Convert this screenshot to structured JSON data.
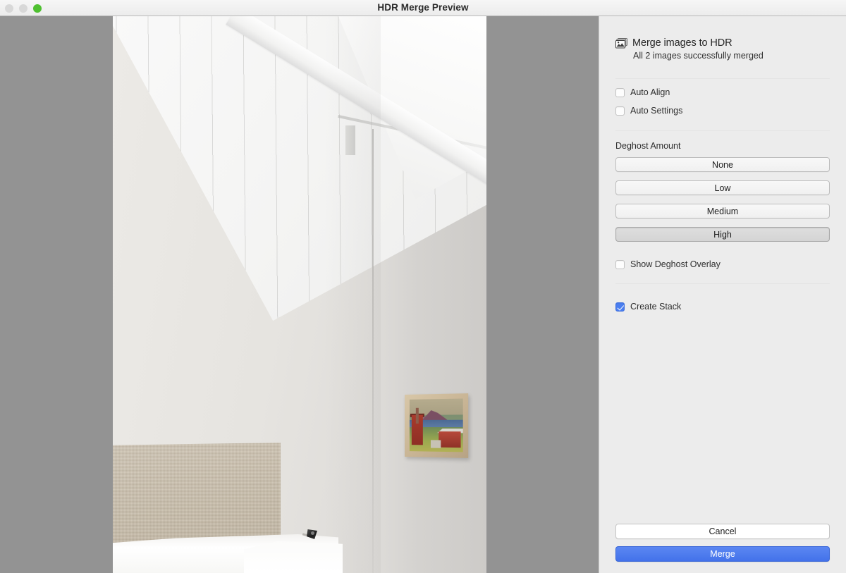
{
  "window": {
    "title": "HDR Merge Preview",
    "traffic_lights": [
      {
        "name": "close",
        "color": "#d8d8d8"
      },
      {
        "name": "minimize",
        "color": "#d8d8d8"
      },
      {
        "name": "zoom",
        "color": "#4ec030"
      }
    ],
    "canvas_background": "#939393"
  },
  "preview": {
    "alt": "Attic bedroom with sloped white plank ceiling, linen headboard, white bedding, small framed landscape painting and black reading lamp"
  },
  "panel": {
    "icon": "photo-stack-icon",
    "title": "Merge images to HDR",
    "subtitle": "All 2 images successfully merged",
    "options": [
      {
        "id": "auto-align",
        "label": "Auto Align",
        "checked": false
      },
      {
        "id": "auto-settings",
        "label": "Auto Settings",
        "checked": false
      }
    ],
    "deghost": {
      "label": "Deghost Amount",
      "selected": "High",
      "choices": [
        {
          "id": "none",
          "label": "None"
        },
        {
          "id": "low",
          "label": "Low"
        },
        {
          "id": "medium",
          "label": "Medium"
        },
        {
          "id": "high",
          "label": "High"
        }
      ]
    },
    "overlay": {
      "id": "show-deghost-overlay",
      "label": "Show Deghost Overlay",
      "checked": false
    },
    "stack": {
      "id": "create-stack",
      "label": "Create Stack",
      "checked": true
    },
    "footer": {
      "cancel_label": "Cancel",
      "merge_label": "Merge",
      "merge_color": "#4a7ef0"
    }
  }
}
